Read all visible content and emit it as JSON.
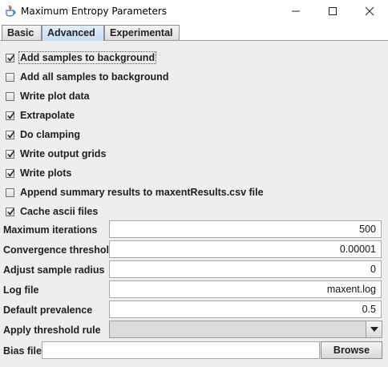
{
  "window": {
    "title": "Maximum Entropy Parameters",
    "icon": "java-coffee-cup-icon"
  },
  "tabs": [
    {
      "label": "Basic",
      "selected": false
    },
    {
      "label": "Advanced",
      "selected": true
    },
    {
      "label": "Experimental",
      "selected": false
    }
  ],
  "checkboxes": [
    {
      "label": "Add samples to background",
      "checked": true,
      "focused": true
    },
    {
      "label": "Add all samples to background",
      "checked": false
    },
    {
      "label": "Write plot data",
      "checked": false
    },
    {
      "label": "Extrapolate",
      "checked": true
    },
    {
      "label": "Do clamping",
      "checked": true
    },
    {
      "label": "Write output grids",
      "checked": true
    },
    {
      "label": "Write plots",
      "checked": true
    },
    {
      "label": "Append summary results to maxentResults.csv file",
      "checked": false
    },
    {
      "label": "Cache ascii files",
      "checked": true
    }
  ],
  "fields": [
    {
      "label": "Maximum iterations",
      "value": "500"
    },
    {
      "label": "Convergence threshold",
      "value": "0.00001"
    },
    {
      "label": "Adjust sample radius",
      "value": "0"
    },
    {
      "label": "Log file",
      "value": "maxent.log"
    },
    {
      "label": "Default prevalence",
      "value": "0.5"
    }
  ],
  "threshold": {
    "label": "Apply threshold rule",
    "value": ""
  },
  "bias": {
    "label": "Bias file",
    "value": "",
    "browse_label": "Browse"
  }
}
